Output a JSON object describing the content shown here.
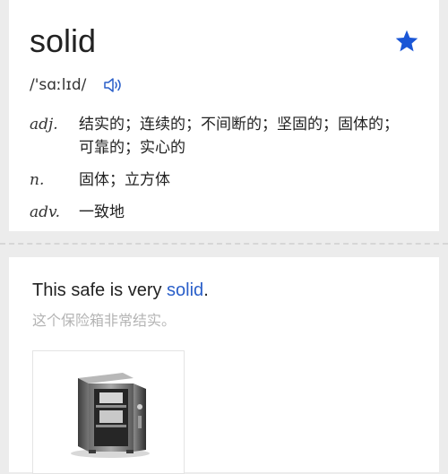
{
  "entry": {
    "word": "solid",
    "phonetic": "/'sɑːlɪd/",
    "favorited": true,
    "accent_color": "#1a56d6"
  },
  "definitions": [
    {
      "pos": "adj.",
      "meaning": "结实的；连续的；不间断的；坚固的；固体的；可靠的；实心的"
    },
    {
      "pos": "n.",
      "meaning": "固体；立方体"
    },
    {
      "pos": "adv.",
      "meaning": "一致地"
    }
  ],
  "example": {
    "en_before": "This safe is very ",
    "en_highlight": "solid",
    "en_after": ".",
    "cn": "这个保险箱非常结实。",
    "highlight_color": "#2a5fc9"
  },
  "icons": {
    "favorite": "star-icon",
    "pronunciation": "speaker-icon"
  }
}
